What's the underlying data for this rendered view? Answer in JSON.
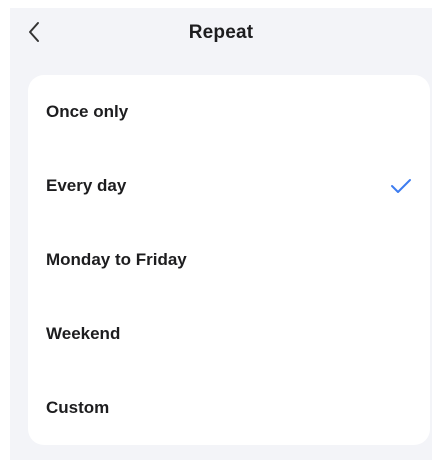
{
  "header": {
    "title": "Repeat",
    "back_icon": "chevron-left-icon"
  },
  "options": [
    {
      "label": "Once only",
      "selected": false
    },
    {
      "label": "Every day",
      "selected": true
    },
    {
      "label": "Monday to Friday",
      "selected": false
    },
    {
      "label": "Weekend",
      "selected": false
    },
    {
      "label": "Custom",
      "selected": false
    }
  ],
  "colors": {
    "accent": "#3d7cf0",
    "background": "#f3f4f8",
    "card": "#ffffff",
    "text": "#1d1d1f"
  },
  "icons": {
    "selected": "checkmark-icon"
  }
}
